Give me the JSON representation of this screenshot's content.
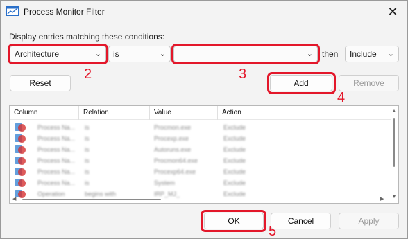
{
  "window": {
    "title": "Process Monitor Filter",
    "close_glyph": "✕"
  },
  "filter": {
    "prompt": "Display entries matching these conditions:",
    "column_value": "Architecture",
    "relation_value": "is",
    "value_value": "",
    "then_label": "then",
    "action_value": "Include",
    "chevron_glyph": "⌄"
  },
  "buttons": {
    "reset": "Reset",
    "add": "Add",
    "remove": "Remove",
    "ok": "OK",
    "cancel": "Cancel",
    "apply": "Apply"
  },
  "steps": {
    "column": "2",
    "value": "3",
    "add": "4",
    "ok": "5"
  },
  "list": {
    "columns": [
      "Column",
      "Relation",
      "Value",
      "Action"
    ],
    "rows": [
      [
        "Process Na...",
        "is",
        "Procmon.exe",
        "Exclude"
      ],
      [
        "Process Na...",
        "is",
        "Procexp.exe",
        "Exclude"
      ],
      [
        "Process Na...",
        "is",
        "Autoruns.exe",
        "Exclude"
      ],
      [
        "Process Na...",
        "is",
        "Procmon64.exe",
        "Exclude"
      ],
      [
        "Process Na...",
        "is",
        "Procexp64.exe",
        "Exclude"
      ],
      [
        "Process Na...",
        "is",
        "System",
        "Exclude"
      ],
      [
        "Operation",
        "begins with",
        "IRP_MJ_",
        "Exclude"
      ]
    ]
  },
  "colors": {
    "highlight": "#e3172a",
    "window_bg": "#f3f3f3"
  }
}
